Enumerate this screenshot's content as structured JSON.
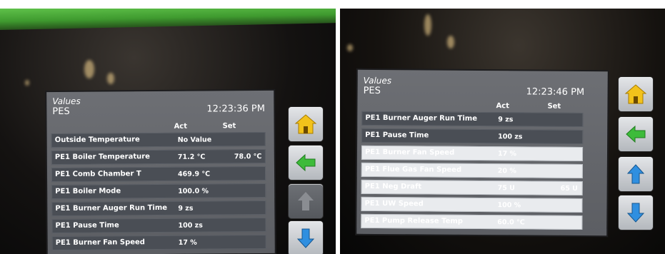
{
  "left_panel": {
    "screen": {
      "title": "Values",
      "subtitle": "PES",
      "time": "12:23:36 PM",
      "col_act": "Act",
      "col_set": "Set",
      "rows": [
        {
          "label": "Outside Temperature",
          "act": "No Value",
          "set": ""
        },
        {
          "label": "PE1 Boiler Temperature",
          "act": "71.2 °C",
          "set": "78.0 °C"
        },
        {
          "label": "PE1 Comb Chamber T",
          "act": "469.9 °C",
          "set": ""
        },
        {
          "label": "PE1 Boiler Mode",
          "act": "100.0 %",
          "set": ""
        },
        {
          "label": "PE1 Burner Auger Run Time",
          "act": "9 zs",
          "set": ""
        },
        {
          "label": "PE1 Pause Time",
          "act": "100 zs",
          "set": ""
        },
        {
          "label": "PE1 Burner Fan Speed",
          "act": "17 %",
          "set": ""
        }
      ]
    },
    "nav_buttons": [
      {
        "name": "home-icon",
        "enabled": true
      },
      {
        "name": "back-arrow-icon",
        "enabled": true
      },
      {
        "name": "up-arrow-icon",
        "enabled": false
      },
      {
        "name": "down-arrow-icon",
        "enabled": true
      }
    ]
  },
  "right_panel": {
    "screen": {
      "title": "Values",
      "subtitle": "PES",
      "time": "12:23:46 PM",
      "col_act": "Act",
      "col_set": "Set",
      "rows": [
        {
          "label": "PE1 Burner Auger Run Time",
          "act": "9 zs",
          "set": ""
        },
        {
          "label": "PE1 Pause Time",
          "act": "100 zs",
          "set": ""
        },
        {
          "label": "PE1 Burner Fan Speed",
          "act": "17 %",
          "set": ""
        },
        {
          "label": "PE1 Flue Gas Fan Speed",
          "act": "20 %",
          "set": ""
        },
        {
          "label": "PE1 Neg Draft",
          "act": "75 U",
          "set": "65 U"
        },
        {
          "label": "PE1 UW Speed",
          "act": "100 %",
          "set": ""
        },
        {
          "label": "PE1 Pump Release Temp",
          "act": "60.0 °C",
          "set": ""
        }
      ]
    },
    "nav_buttons": [
      {
        "name": "home-icon",
        "enabled": true
      },
      {
        "name": "back-arrow-icon",
        "enabled": true
      },
      {
        "name": "up-arrow-icon",
        "enabled": true
      },
      {
        "name": "down-arrow-icon",
        "enabled": true
      }
    ]
  },
  "colors": {
    "home": "#f2c21b",
    "back": "#3dbb3a",
    "updown": "#2f8fe0",
    "disabled": "#8a8d92"
  }
}
